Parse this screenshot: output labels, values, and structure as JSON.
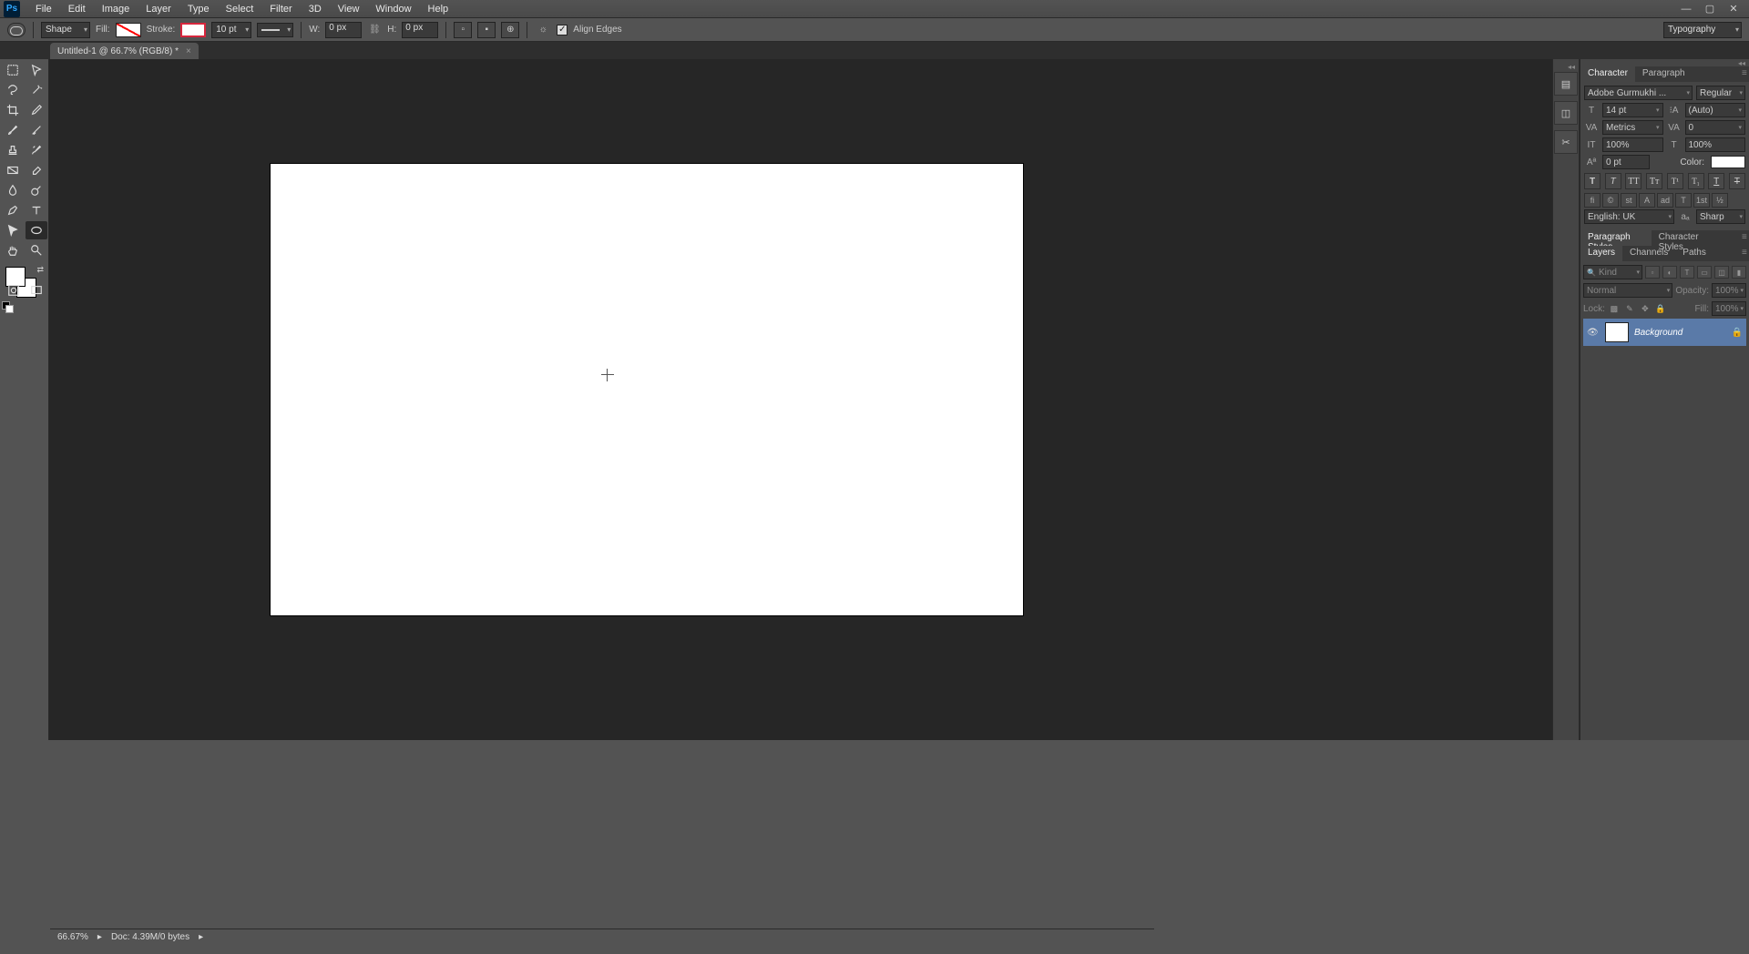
{
  "menubar": {
    "items": [
      "File",
      "Edit",
      "Image",
      "Layer",
      "Type",
      "Select",
      "Filter",
      "3D",
      "View",
      "Window",
      "Help"
    ]
  },
  "optionsbar": {
    "tool_mode": "Shape",
    "fill_label": "Fill:",
    "stroke_label": "Stroke:",
    "stroke_width": "10 pt",
    "w_label": "W:",
    "w_value": "0 px",
    "h_label": "H:",
    "h_value": "0 px",
    "align_edges": "Align Edges",
    "workspace": "Typography"
  },
  "document": {
    "tab_title": "Untitled-1 @ 66.7% (RGB/8) *"
  },
  "panels": {
    "char_tab": "Character",
    "para_tab": "Paragraph",
    "font_family": "Adobe Gurmukhi ...",
    "font_style": "Regular",
    "font_size": "14 pt",
    "leading": "(Auto)",
    "kerning": "Metrics",
    "tracking": "0",
    "vscale": "100%",
    "hscale": "100%",
    "baseline": "0 pt",
    "color_label": "Color:",
    "language": "English: UK",
    "antialias": "Sharp",
    "para_styles_tab": "Paragraph Styles",
    "char_styles_tab": "Character Styles",
    "layers_tab": "Layers",
    "channels_tab": "Channels",
    "paths_tab": "Paths",
    "kind_label": "Kind",
    "blend_mode": "Normal",
    "opacity_label": "Opacity:",
    "opacity_value": "100%",
    "lock_label": "Lock:",
    "fill_label": "Fill:",
    "fill_value": "100%",
    "layer_name": "Background"
  },
  "statusbar": {
    "zoom": "66.67%",
    "doc_info": "Doc: 4.39M/0 bytes"
  }
}
